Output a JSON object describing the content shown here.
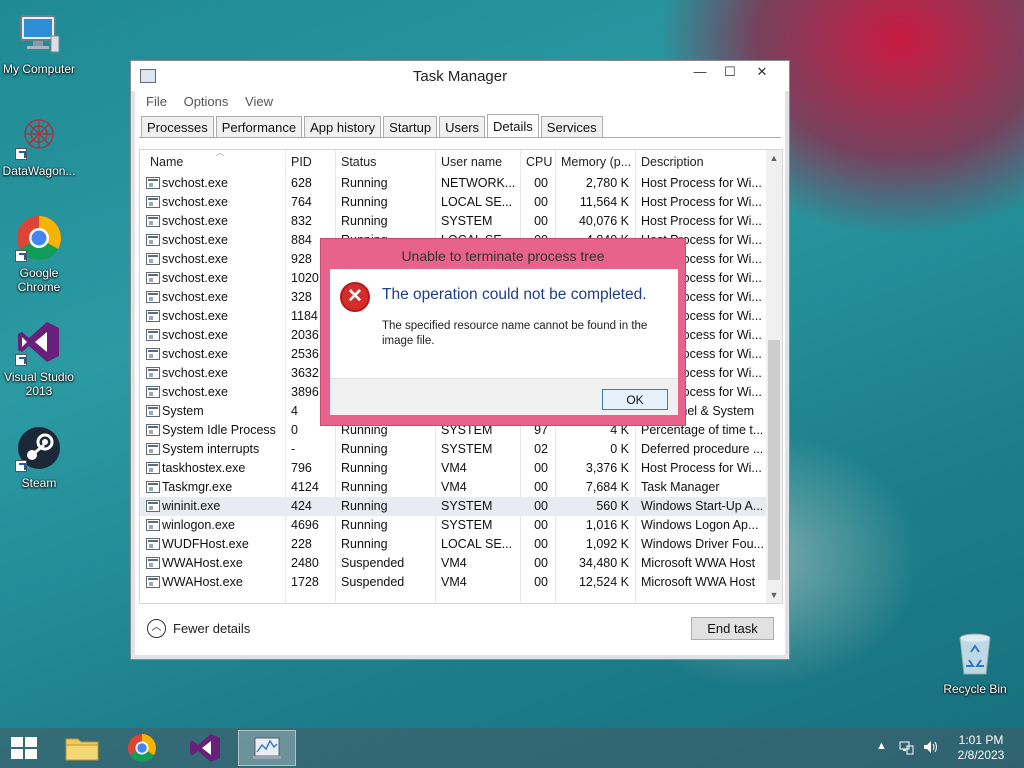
{
  "desktop": {
    "icons": [
      {
        "label": "My Computer"
      },
      {
        "label": "DataWagon..."
      },
      {
        "label": "Google Chrome"
      },
      {
        "label": "Visual Studio 2013"
      },
      {
        "label": "Steam"
      },
      {
        "label": "Recycle Bin"
      }
    ]
  },
  "window": {
    "title": "Task Manager",
    "controls": {
      "minimize": "—",
      "maximize": "☐",
      "close": "✕"
    },
    "menu": [
      "File",
      "Options",
      "View"
    ],
    "tabs": [
      "Processes",
      "Performance",
      "App history",
      "Startup",
      "Users",
      "Details",
      "Services"
    ],
    "active_tab": "Details",
    "columns": [
      "Name",
      "PID",
      "Status",
      "User name",
      "CPU",
      "Memory (p...",
      "Description"
    ],
    "rows": [
      [
        "svchost.exe",
        "628",
        "Running",
        "NETWORK...",
        "00",
        "2,780 K",
        "Host Process for Wi..."
      ],
      [
        "svchost.exe",
        "764",
        "Running",
        "LOCAL SE...",
        "00",
        "11,564 K",
        "Host Process for Wi..."
      ],
      [
        "svchost.exe",
        "832",
        "Running",
        "SYSTEM",
        "00",
        "40,076 K",
        "Host Process for Wi..."
      ],
      [
        "svchost.exe",
        "884",
        "Running",
        "LOCAL SE...",
        "00",
        "4,840 K",
        "Host Process for Wi..."
      ],
      [
        "svchost.exe",
        "928",
        "",
        "",
        "",
        "",
        "Host Process for Wi..."
      ],
      [
        "svchost.exe",
        "1020",
        "",
        "",
        "",
        "",
        "Host Process for Wi..."
      ],
      [
        "svchost.exe",
        "328",
        "",
        "",
        "",
        "",
        "Host Process for Wi..."
      ],
      [
        "svchost.exe",
        "1184",
        "",
        "",
        "",
        "",
        "Host Process for Wi..."
      ],
      [
        "svchost.exe",
        "2036",
        "",
        "",
        "",
        "",
        "Host Process for Wi..."
      ],
      [
        "svchost.exe",
        "2536",
        "",
        "",
        "",
        "",
        "Host Process for Wi..."
      ],
      [
        "svchost.exe",
        "3632",
        "",
        "",
        "",
        "",
        "Host Process for Wi..."
      ],
      [
        "svchost.exe",
        "3896",
        "",
        "",
        "",
        "",
        "Host Process for Wi..."
      ],
      [
        "System",
        "4",
        "",
        "",
        "",
        "",
        "NT Kernel & System"
      ],
      [
        "System Idle Process",
        "0",
        "Running",
        "SYSTEM",
        "97",
        "4 K",
        "Percentage of time t..."
      ],
      [
        "System interrupts",
        "-",
        "Running",
        "SYSTEM",
        "02",
        "0 K",
        "Deferred procedure ..."
      ],
      [
        "taskhostex.exe",
        "796",
        "Running",
        "VM4",
        "00",
        "3,376 K",
        "Host Process for Wi..."
      ],
      [
        "Taskmgr.exe",
        "4124",
        "Running",
        "VM4",
        "00",
        "7,684 K",
        "Task Manager"
      ],
      [
        "wininit.exe",
        "424",
        "Running",
        "SYSTEM",
        "00",
        "560 K",
        "Windows Start-Up A..."
      ],
      [
        "winlogon.exe",
        "4696",
        "Running",
        "SYSTEM",
        "00",
        "1,016 K",
        "Windows Logon Ap..."
      ],
      [
        "WUDFHost.exe",
        "228",
        "Running",
        "LOCAL SE...",
        "00",
        "1,092 K",
        "Windows Driver Fou..."
      ],
      [
        "WWAHost.exe",
        "2480",
        "Suspended",
        "VM4",
        "00",
        "34,480 K",
        "Microsoft WWA Host"
      ],
      [
        "WWAHost.exe",
        "1728",
        "Suspended",
        "VM4",
        "00",
        "12,524 K",
        "Microsoft WWA Host"
      ]
    ],
    "selected_row": 17,
    "fewer_details": "Fewer details",
    "end_task": "End task"
  },
  "dialog": {
    "title": "Unable to terminate process tree",
    "heading": "The operation could not be completed.",
    "message": "The specified resource name cannot be found in the image file.",
    "ok": "OK"
  },
  "taskbar": {
    "time": "1:01 PM",
    "date": "2/8/2023"
  },
  "colors": {
    "dialog_frame": "#e8638c",
    "dialog_heading": "#1e3d8c",
    "error_icon": "#d42b2b"
  }
}
